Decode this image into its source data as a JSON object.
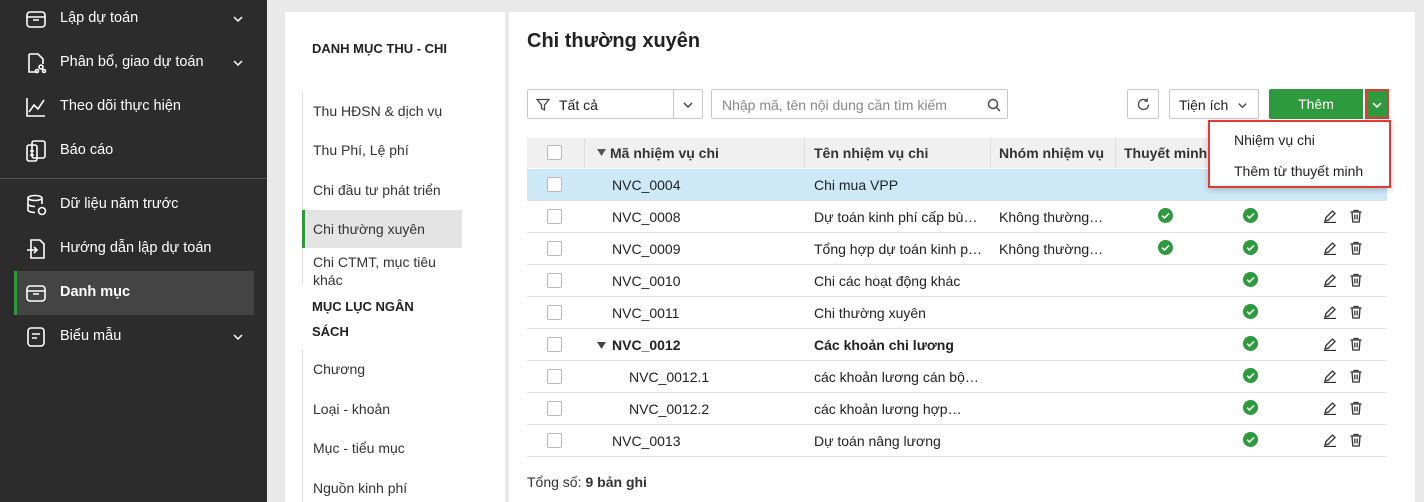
{
  "sidebar": {
    "items": [
      {
        "label": "Lập dự toán"
      },
      {
        "label": "Phân bổ, giao dự toán"
      },
      {
        "label": "Theo dõi thực hiện"
      },
      {
        "label": "Báo cáo"
      },
      {
        "label": "Dữ liệu năm trước"
      },
      {
        "label": "Hướng dẫn lập dự toán"
      },
      {
        "label": "Danh mục"
      },
      {
        "label": "Biểu mẫu"
      }
    ]
  },
  "categories": {
    "section1": "DANH MỤC THU - CHI",
    "items1": [
      "Thu HĐSN & dịch vụ",
      "Thu Phí, Lệ phí",
      "Chi đầu tư phát triển",
      "Chi thường xuyên",
      "Chi CTMT, mục tiêu khác"
    ],
    "section2": "MỤC LỤC NGÂN SÁCH",
    "items2": [
      "Chương",
      "Loại - khoản",
      "Mục - tiểu mục",
      "Nguồn kinh phí"
    ]
  },
  "main": {
    "title": "Chi thường xuyên",
    "filter_value": "Tất cả",
    "search_placeholder": "Nhập mã, tên nội dung cần tìm kiếm",
    "utilities_label": "Tiện ích",
    "add_label": "Thêm",
    "columns": [
      "Mã nhiệm vụ chi",
      "Tên nhiệm vụ chi",
      "Nhóm nhiệm vụ",
      "Thuyết minh"
    ],
    "rows": [
      {
        "code": "NVC_0004",
        "name": "Chi mua VPP",
        "group": "",
        "explain": false,
        "active": false
      },
      {
        "code": "NVC_0008",
        "name": "Dự toán kinh phí cấp bù…",
        "group": "Không thường…",
        "explain": true,
        "active": true
      },
      {
        "code": "NVC_0009",
        "name": "Tổng hợp dự toán kinh p…",
        "group": "Không thường…",
        "explain": true,
        "active": true
      },
      {
        "code": "NVC_0010",
        "name": "Chi các hoạt động khác",
        "group": "",
        "explain": false,
        "active": true
      },
      {
        "code": "NVC_0011",
        "name": "Chi thường xuyên",
        "group": "",
        "explain": false,
        "active": true
      },
      {
        "code": "NVC_0012",
        "name": "Các khoản chi lương",
        "group": "",
        "explain": false,
        "active": true
      },
      {
        "code": "NVC_0012.1",
        "name": "các khoản lương cán bộ…",
        "group": "",
        "explain": false,
        "active": true
      },
      {
        "code": "NVC_0012.2",
        "name": "các khoản lương hợp…",
        "group": "",
        "explain": false,
        "active": true
      },
      {
        "code": "NVC_0013",
        "name": "Dự toán nâng lương",
        "group": "",
        "explain": false,
        "active": true
      }
    ],
    "footer_label": "Tổng số:",
    "footer_count": "9 bản ghi"
  },
  "dropdown_menu": {
    "items": [
      "Nhiệm vụ chi",
      "Thêm từ thuyết minh"
    ]
  },
  "colors": {
    "accent": "#2e9a3e",
    "sidebar_bg": "#2c2c2c",
    "selected_row": "#cde8f6",
    "highlight": "#e53935"
  }
}
